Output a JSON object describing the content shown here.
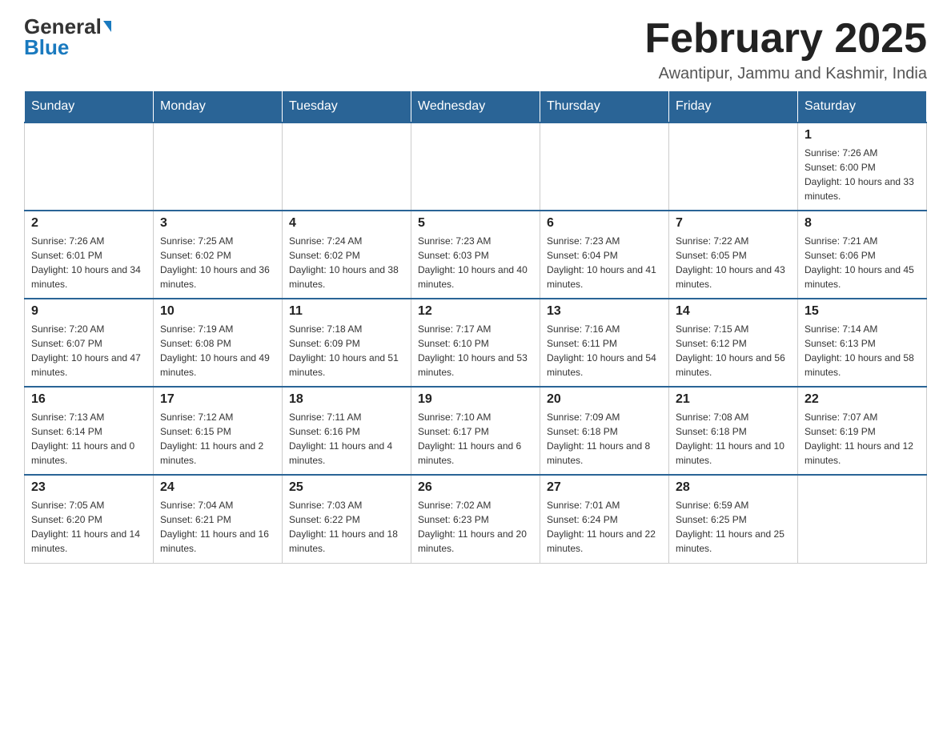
{
  "logo": {
    "general": "General",
    "blue": "Blue"
  },
  "title": {
    "month": "February 2025",
    "location": "Awantipur, Jammu and Kashmir, India"
  },
  "days_of_week": [
    "Sunday",
    "Monday",
    "Tuesday",
    "Wednesday",
    "Thursday",
    "Friday",
    "Saturday"
  ],
  "weeks": [
    [
      {
        "day": "",
        "info": ""
      },
      {
        "day": "",
        "info": ""
      },
      {
        "day": "",
        "info": ""
      },
      {
        "day": "",
        "info": ""
      },
      {
        "day": "",
        "info": ""
      },
      {
        "day": "",
        "info": ""
      },
      {
        "day": "1",
        "info": "Sunrise: 7:26 AM\nSunset: 6:00 PM\nDaylight: 10 hours and 33 minutes."
      }
    ],
    [
      {
        "day": "2",
        "info": "Sunrise: 7:26 AM\nSunset: 6:01 PM\nDaylight: 10 hours and 34 minutes."
      },
      {
        "day": "3",
        "info": "Sunrise: 7:25 AM\nSunset: 6:02 PM\nDaylight: 10 hours and 36 minutes."
      },
      {
        "day": "4",
        "info": "Sunrise: 7:24 AM\nSunset: 6:02 PM\nDaylight: 10 hours and 38 minutes."
      },
      {
        "day": "5",
        "info": "Sunrise: 7:23 AM\nSunset: 6:03 PM\nDaylight: 10 hours and 40 minutes."
      },
      {
        "day": "6",
        "info": "Sunrise: 7:23 AM\nSunset: 6:04 PM\nDaylight: 10 hours and 41 minutes."
      },
      {
        "day": "7",
        "info": "Sunrise: 7:22 AM\nSunset: 6:05 PM\nDaylight: 10 hours and 43 minutes."
      },
      {
        "day": "8",
        "info": "Sunrise: 7:21 AM\nSunset: 6:06 PM\nDaylight: 10 hours and 45 minutes."
      }
    ],
    [
      {
        "day": "9",
        "info": "Sunrise: 7:20 AM\nSunset: 6:07 PM\nDaylight: 10 hours and 47 minutes."
      },
      {
        "day": "10",
        "info": "Sunrise: 7:19 AM\nSunset: 6:08 PM\nDaylight: 10 hours and 49 minutes."
      },
      {
        "day": "11",
        "info": "Sunrise: 7:18 AM\nSunset: 6:09 PM\nDaylight: 10 hours and 51 minutes."
      },
      {
        "day": "12",
        "info": "Sunrise: 7:17 AM\nSunset: 6:10 PM\nDaylight: 10 hours and 53 minutes."
      },
      {
        "day": "13",
        "info": "Sunrise: 7:16 AM\nSunset: 6:11 PM\nDaylight: 10 hours and 54 minutes."
      },
      {
        "day": "14",
        "info": "Sunrise: 7:15 AM\nSunset: 6:12 PM\nDaylight: 10 hours and 56 minutes."
      },
      {
        "day": "15",
        "info": "Sunrise: 7:14 AM\nSunset: 6:13 PM\nDaylight: 10 hours and 58 minutes."
      }
    ],
    [
      {
        "day": "16",
        "info": "Sunrise: 7:13 AM\nSunset: 6:14 PM\nDaylight: 11 hours and 0 minutes."
      },
      {
        "day": "17",
        "info": "Sunrise: 7:12 AM\nSunset: 6:15 PM\nDaylight: 11 hours and 2 minutes."
      },
      {
        "day": "18",
        "info": "Sunrise: 7:11 AM\nSunset: 6:16 PM\nDaylight: 11 hours and 4 minutes."
      },
      {
        "day": "19",
        "info": "Sunrise: 7:10 AM\nSunset: 6:17 PM\nDaylight: 11 hours and 6 minutes."
      },
      {
        "day": "20",
        "info": "Sunrise: 7:09 AM\nSunset: 6:18 PM\nDaylight: 11 hours and 8 minutes."
      },
      {
        "day": "21",
        "info": "Sunrise: 7:08 AM\nSunset: 6:18 PM\nDaylight: 11 hours and 10 minutes."
      },
      {
        "day": "22",
        "info": "Sunrise: 7:07 AM\nSunset: 6:19 PM\nDaylight: 11 hours and 12 minutes."
      }
    ],
    [
      {
        "day": "23",
        "info": "Sunrise: 7:05 AM\nSunset: 6:20 PM\nDaylight: 11 hours and 14 minutes."
      },
      {
        "day": "24",
        "info": "Sunrise: 7:04 AM\nSunset: 6:21 PM\nDaylight: 11 hours and 16 minutes."
      },
      {
        "day": "25",
        "info": "Sunrise: 7:03 AM\nSunset: 6:22 PM\nDaylight: 11 hours and 18 minutes."
      },
      {
        "day": "26",
        "info": "Sunrise: 7:02 AM\nSunset: 6:23 PM\nDaylight: 11 hours and 20 minutes."
      },
      {
        "day": "27",
        "info": "Sunrise: 7:01 AM\nSunset: 6:24 PM\nDaylight: 11 hours and 22 minutes."
      },
      {
        "day": "28",
        "info": "Sunrise: 6:59 AM\nSunset: 6:25 PM\nDaylight: 11 hours and 25 minutes."
      },
      {
        "day": "",
        "info": ""
      }
    ]
  ]
}
